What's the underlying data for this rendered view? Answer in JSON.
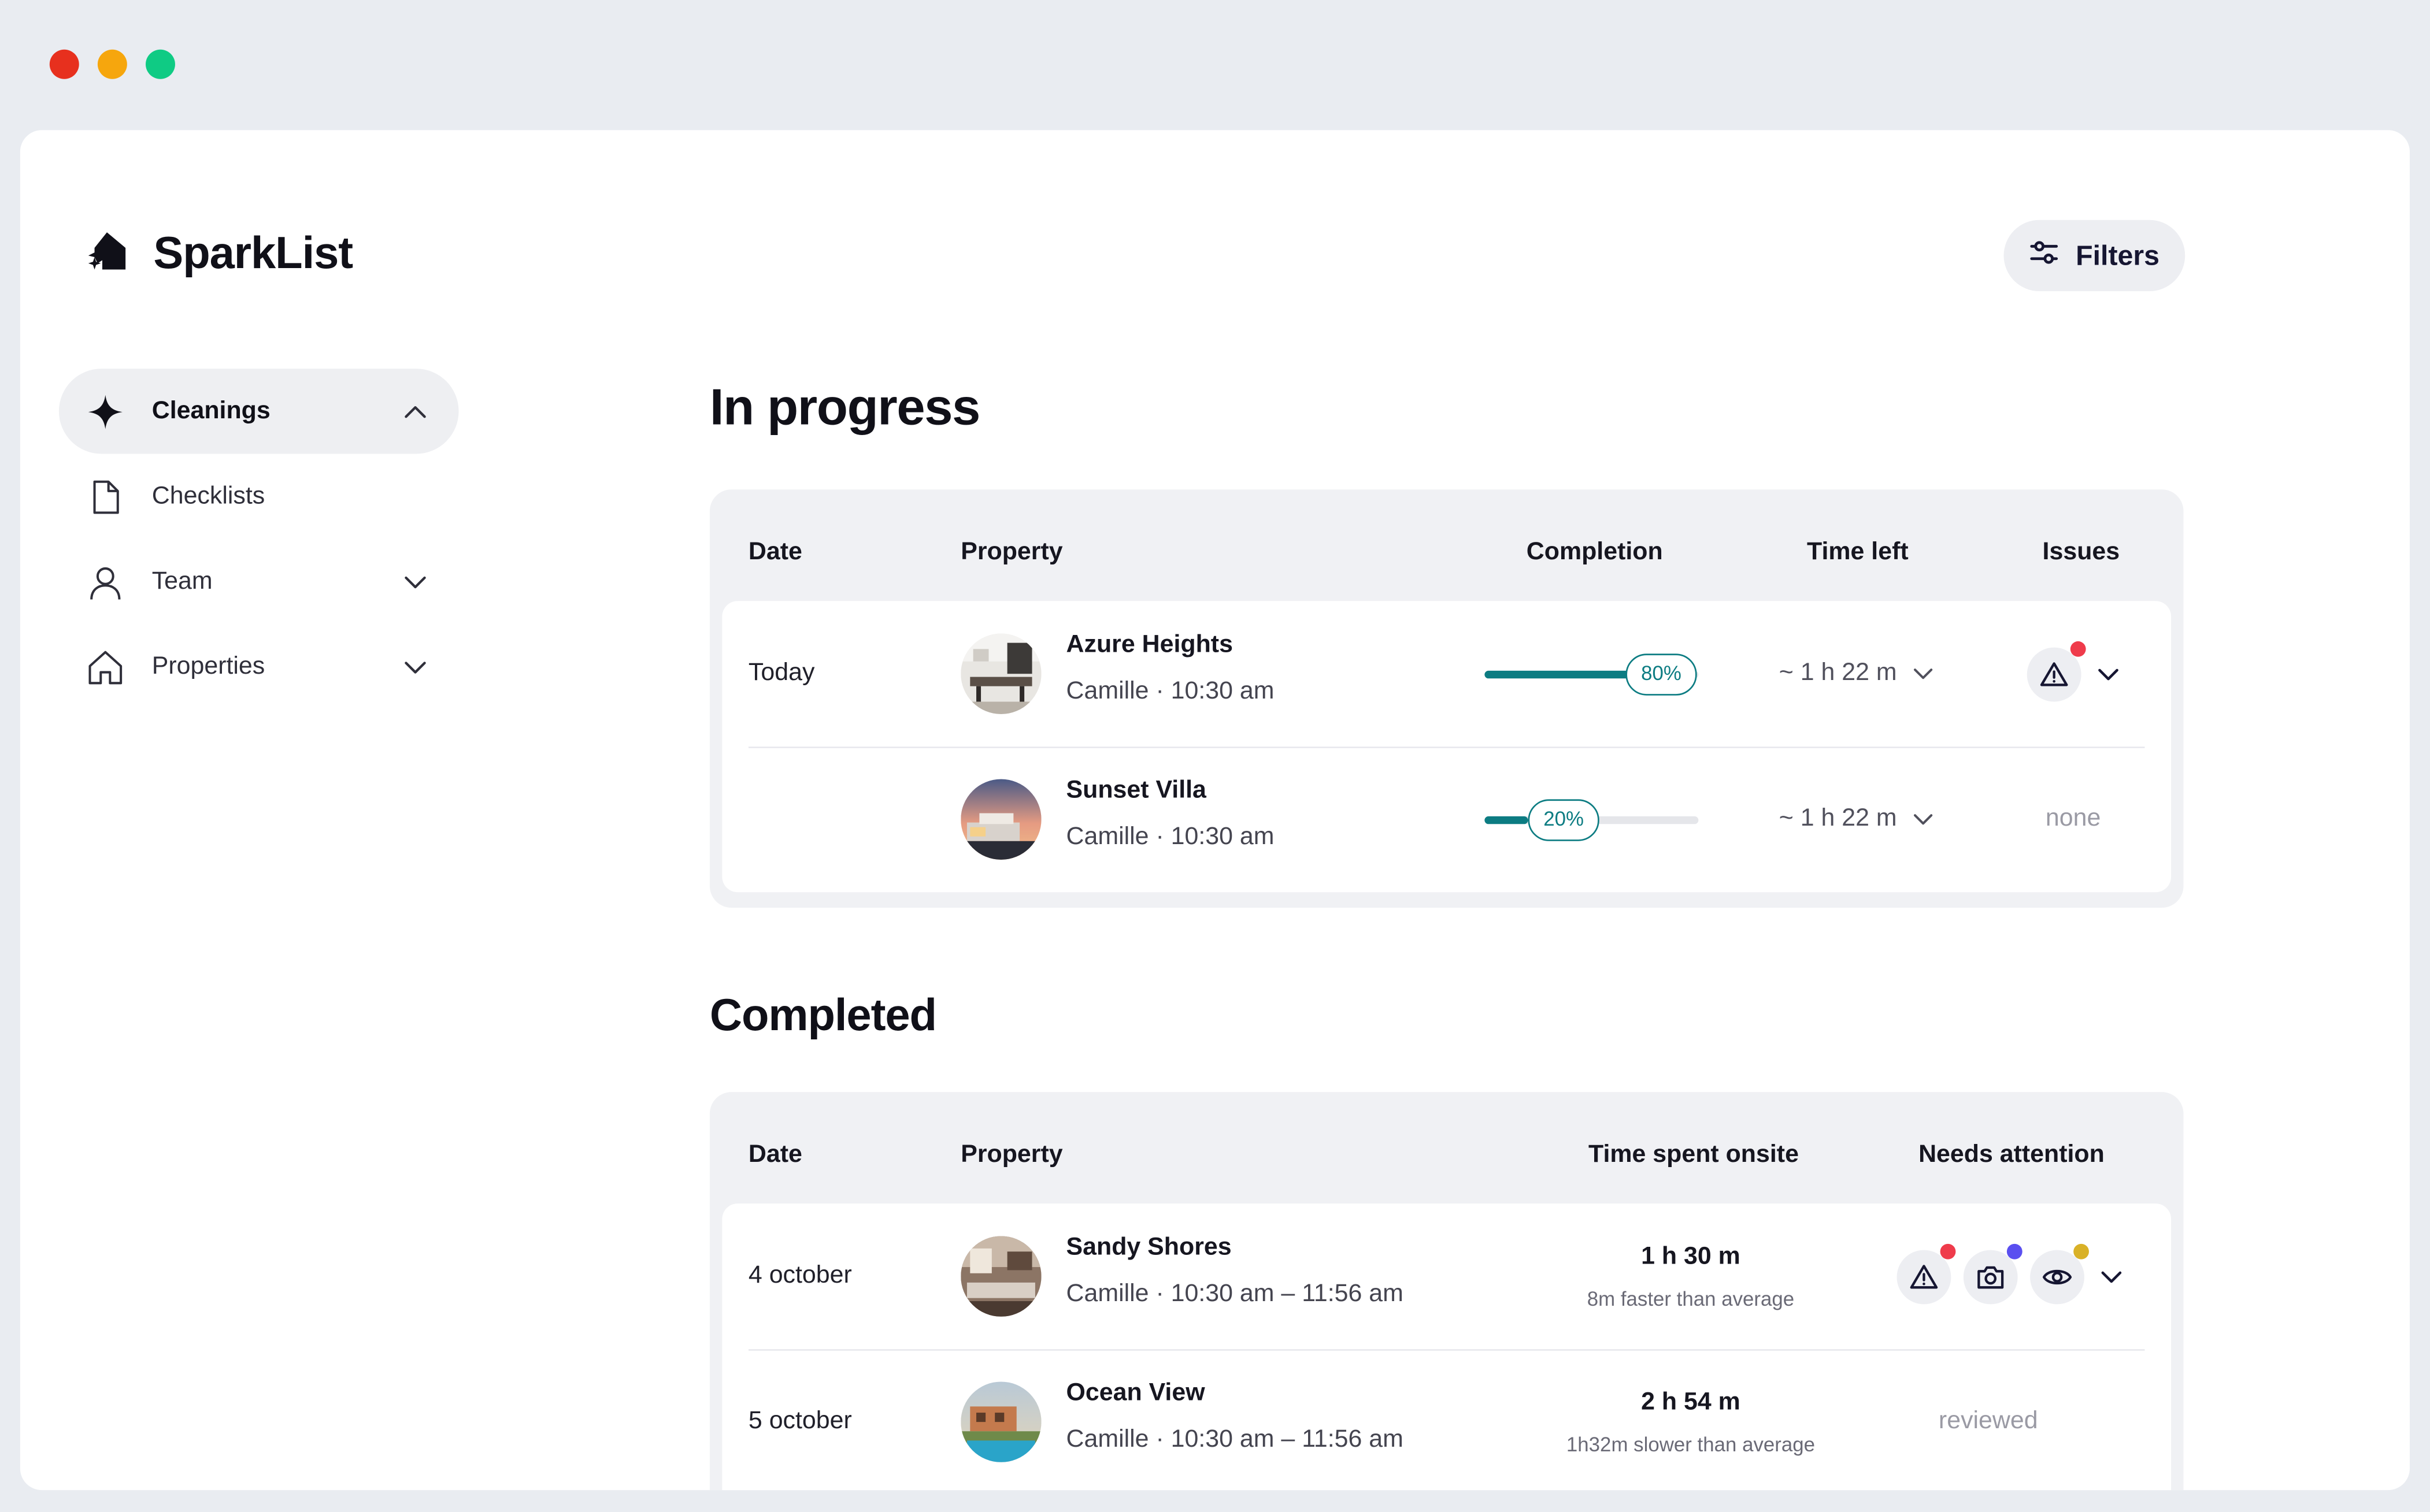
{
  "window": {
    "controls": [
      {
        "name": "close",
        "color": "#e7301e"
      },
      {
        "name": "minimize",
        "color": "#f6a60d"
      },
      {
        "name": "zoom",
        "color": "#0fcb84"
      }
    ]
  },
  "brand": {
    "name": "SparkList",
    "icon": "sparkle-house-icon"
  },
  "filters": {
    "label": "Filters",
    "icon": "sliders-icon"
  },
  "sidebar": {
    "items": [
      {
        "label": "Cleanings",
        "icon": "sparkle-icon",
        "active": true,
        "chevron": "up"
      },
      {
        "label": "Checklists",
        "icon": "document-icon",
        "active": false,
        "chevron": null
      },
      {
        "label": "Team",
        "icon": "user-icon",
        "active": false,
        "chevron": "down"
      },
      {
        "label": "Properties",
        "icon": "house-icon",
        "active": false,
        "chevron": "down"
      }
    ]
  },
  "in_progress": {
    "title": "In progress",
    "headers": {
      "date": "Date",
      "property": "Property",
      "completion": "Completion",
      "time_left": "Time left",
      "issues": "Issues"
    },
    "rows": [
      {
        "date": "Today",
        "property": "Azure Heights",
        "sub": "Camille · 10:30 am",
        "completion": 80,
        "completion_label": "80%",
        "time_left": "~ 1 h 22 m",
        "issues": "warning",
        "issues_badge": "#ef3b4b"
      },
      {
        "date": "",
        "property": "Sunset Villa",
        "sub": "Camille · 10:30 am",
        "completion": 20,
        "completion_label": "20%",
        "time_left": "~ 1 h 22 m",
        "issues": "none"
      }
    ]
  },
  "completed": {
    "title": "Completed",
    "headers": {
      "date": "Date",
      "property": "Property",
      "time_spent": "Time spent onsite",
      "needs_attention": "Needs attention"
    },
    "rows": [
      {
        "date": "4 october",
        "property": "Sandy Shores",
        "sub": "Camille · 10:30 am – 11:56 am",
        "time_spent": "1 h 30 m",
        "time_note": "8m faster than average",
        "attention": [
          {
            "icon": "warning-icon",
            "badge": "#ef3b4b"
          },
          {
            "icon": "camera-icon",
            "badge": "#5a4ff0"
          },
          {
            "icon": "eye-icon",
            "badge": "#d9b127"
          }
        ]
      },
      {
        "date": "5 october",
        "property": "Ocean View",
        "sub": "Camille · 10:30 am – 11:56 am",
        "time_spent": "2 h 54 m",
        "time_note": "1h32m slower than average",
        "attention_text": "reviewed"
      }
    ]
  }
}
